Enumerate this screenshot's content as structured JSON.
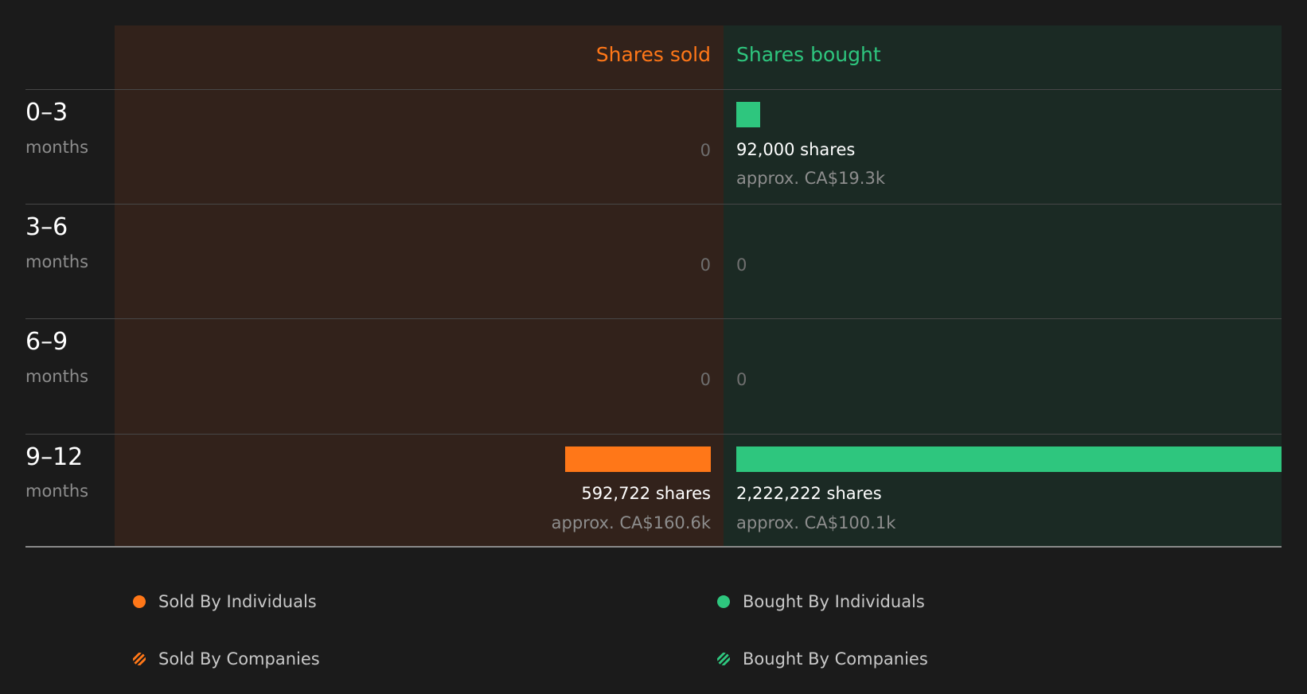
{
  "headers": {
    "sold": "Shares sold",
    "bought": "Shares bought"
  },
  "colors": {
    "sold": "#ff7718",
    "bought": "#2ec67e"
  },
  "periods": [
    {
      "label": "0–3",
      "unit": "months",
      "sold": {
        "value": 0,
        "text": "0"
      },
      "bought": {
        "value": 92000,
        "shares": "92,000 shares",
        "approx": "approx. CA$19.3k"
      }
    },
    {
      "label": "3–6",
      "unit": "months",
      "sold": {
        "value": 0,
        "text": "0"
      },
      "bought": {
        "value": 0,
        "text": "0"
      }
    },
    {
      "label": "6–9",
      "unit": "months",
      "sold": {
        "value": 0,
        "text": "0"
      },
      "bought": {
        "value": 0,
        "text": "0"
      }
    },
    {
      "label": "9–12",
      "unit": "months",
      "sold": {
        "value": 592722,
        "shares": "592,722 shares",
        "approx": "approx. CA$160.6k"
      },
      "bought": {
        "value": 2222222,
        "shares": "2,222,222 shares",
        "approx": "approx. CA$100.1k"
      }
    }
  ],
  "legend": [
    {
      "label": "Sold By Individuals",
      "icon": "orange-dot-icon"
    },
    {
      "label": "Bought By Individuals",
      "icon": "green-dot-icon"
    },
    {
      "label": "Sold By Companies",
      "icon": "orange-striped-dot-icon"
    },
    {
      "label": "Bought By Companies",
      "icon": "green-striped-dot-icon"
    }
  ],
  "chart_data": {
    "type": "bar",
    "categories": [
      "0–3 months",
      "3–6 months",
      "6–9 months",
      "9–12 months"
    ],
    "series": [
      {
        "name": "Shares sold",
        "values": [
          0,
          0,
          0,
          592722
        ]
      },
      {
        "name": "Shares bought",
        "values": [
          92000,
          0,
          0,
          2222222
        ]
      }
    ]
  }
}
